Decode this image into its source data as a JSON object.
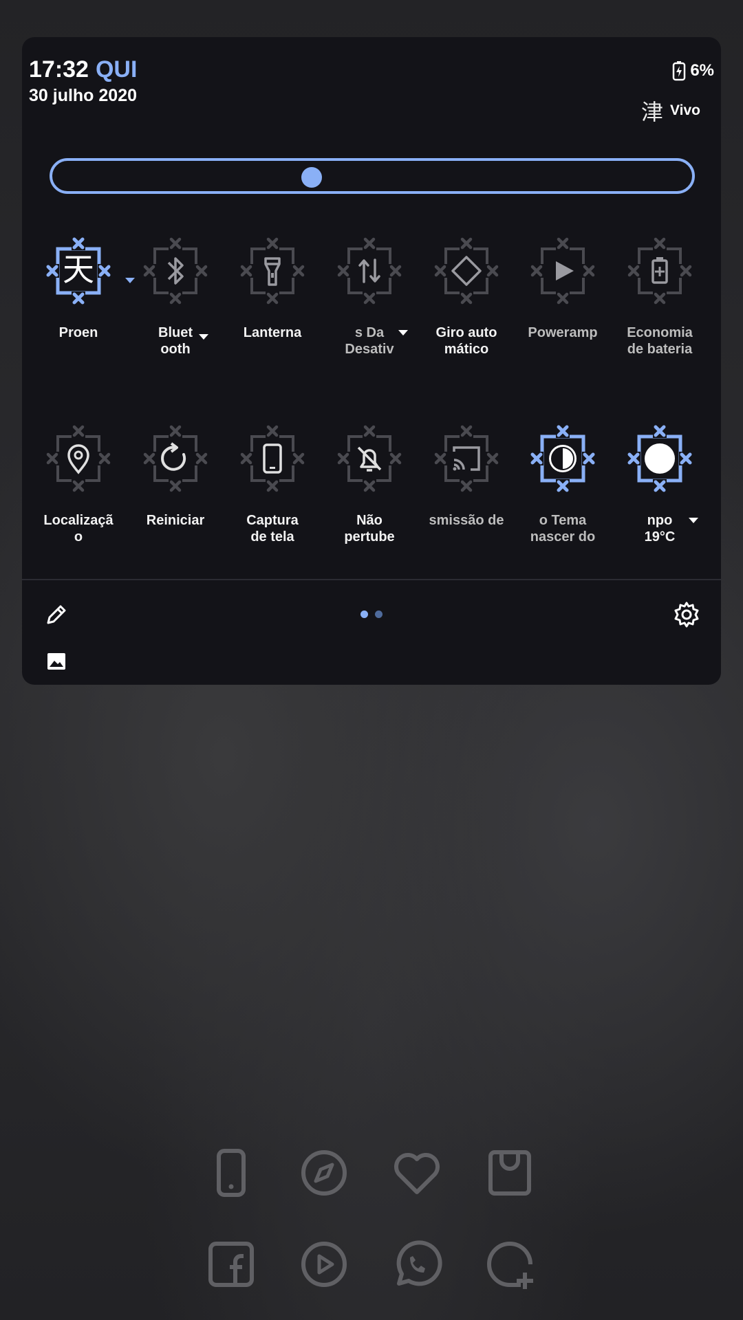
{
  "status": {
    "time": "17:32",
    "day": "QUI",
    "date": "30 julho 2020",
    "battery": "6%",
    "carrier_glyph": "津",
    "carrier": "Vivo"
  },
  "brightness": {
    "level": 0.4
  },
  "tiles": [
    {
      "label": "Proen",
      "icon": "kanji-icon",
      "glyph": "天",
      "active": true,
      "caret": true
    },
    {
      "label": "Bluet\nooth",
      "icon": "bluetooth-icon",
      "active": false,
      "caret": true
    },
    {
      "label": "Lanterna",
      "icon": "flashlight-icon",
      "active": false
    },
    {
      "label": "s   Da\nDesativ",
      "icon": "data-transfer-icon",
      "active": false,
      "caret": true,
      "dim": true
    },
    {
      "label": "Giro auto\nmático",
      "icon": "auto-rotate-icon",
      "active": false
    },
    {
      "label": "Poweramp",
      "icon": "play-icon",
      "active": false,
      "dim": true
    },
    {
      "label": "Economia\nde bateria",
      "icon": "battery-saver-icon",
      "active": false,
      "dim": true
    },
    {
      "label": "Localizaçã\no",
      "icon": "location-icon",
      "active": false
    },
    {
      "label": "Reiniciar",
      "icon": "restart-icon",
      "active": false
    },
    {
      "label": "Captura\nde tela",
      "icon": "screenshot-icon",
      "active": false
    },
    {
      "label": "Não\npertube",
      "icon": "do-not-disturb-icon",
      "active": false
    },
    {
      "label": "smissão de",
      "icon": "cast-icon",
      "active": false,
      "dim": true
    },
    {
      "label": "o       Tema\nnascer do",
      "icon": "theme-icon",
      "active": true,
      "dim": true
    },
    {
      "label": "npo\n19°C",
      "icon": "weather-icon",
      "active": true,
      "caret": true
    }
  ],
  "footer": {
    "page_count": 2,
    "current_page": 1
  },
  "colors": {
    "accent": "#8ab0f6",
    "tile_inactive": "#4a4a50",
    "panel": "#131318"
  },
  "dock": {
    "row1": [
      "phone-icon",
      "compass-icon",
      "heart-icon",
      "shop-icon"
    ],
    "row2": [
      "facebook-icon",
      "play-circle-icon",
      "whatsapp-icon",
      "add-chat-icon"
    ]
  }
}
